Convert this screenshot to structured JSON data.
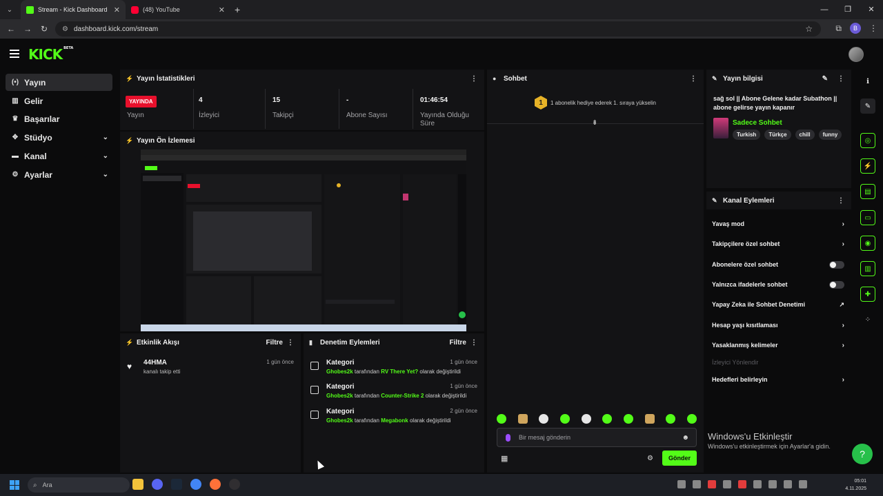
{
  "browser": {
    "tabs": [
      {
        "title": "Stream - Kick Dashboard",
        "favicon": "kick-icon"
      },
      {
        "title": "(48) YouTube",
        "favicon": "youtube-icon"
      }
    ],
    "url": "dashboard.kick.com/stream",
    "profile_initial": "B"
  },
  "brand": {
    "logo": "KICK",
    "badge": "BETA",
    "accent": "#53fc18"
  },
  "sidebar": {
    "items": [
      {
        "label": "Yayın",
        "icon": "broadcast-icon"
      },
      {
        "label": "Gelir",
        "icon": "revenue-icon"
      },
      {
        "label": "Başarılar",
        "icon": "trophy-icon"
      },
      {
        "label": "Stüdyo",
        "icon": "studio-icon"
      },
      {
        "label": "Kanal",
        "icon": "channel-icon"
      },
      {
        "label": "Ayarlar",
        "icon": "settings-icon"
      }
    ]
  },
  "stats": {
    "title": "Yayın İstatistikleri",
    "live_badge": "YAYINDA",
    "live_label": "Yayın",
    "viewers": {
      "value": "4",
      "label": "İzleyici"
    },
    "followers": {
      "value": "15",
      "label": "Takipçi"
    },
    "subscribers": {
      "value": "-",
      "label": "Abone Sayısı"
    },
    "uptime": {
      "value": "01:46:54",
      "label": "Yayında Olduğu Süre"
    }
  },
  "preview": {
    "title": "Yayın Ön İzlemesi"
  },
  "activity": {
    "title": "Etkinlik Akışı",
    "filter": "Filtre",
    "items": [
      {
        "name": "44HMA",
        "text": "kanalı takip etti",
        "time": "1 gün önce"
      }
    ]
  },
  "moderation": {
    "title": "Denetim Eylemleri",
    "filter": "Filtre",
    "items": [
      {
        "title": "Kategori",
        "user": "Ghobes2k",
        "mid": "tarafından",
        "value": "RV There Yet?",
        "end": "olarak değiştirildi",
        "time": "1 gün önce"
      },
      {
        "title": "Kategori",
        "user": "Ghobes2k",
        "mid": "tarafından",
        "value": "Counter-Strike 2",
        "end": "olarak değiştirildi",
        "time": "1 gün önce"
      },
      {
        "title": "Kategori",
        "user": "Ghobes2k",
        "mid": "tarafından",
        "value": "Megabonk",
        "end": "olarak değiştirildi",
        "time": "2 gün önce"
      }
    ]
  },
  "chat": {
    "title": "Sohbet",
    "gift_rank": "1",
    "gift_text": "1 abonelik hediye ederek 1. sıraya yükselin",
    "placeholder": "Bir mesaj gönderin",
    "send": "Gönder"
  },
  "stream_info": {
    "title": "Yayın bilgisi",
    "stream_title": "sağ sol || Abone Gelene kadar Subathon || abone gelirse yayın kapanır",
    "category": "Sadece Sohbet",
    "tags": [
      "Turkish",
      "Türkçe",
      "chill",
      "funny"
    ]
  },
  "channel_actions": {
    "title": "Kanal Eylemleri",
    "items": [
      {
        "label": "Yavaş mod",
        "control": "chevron"
      },
      {
        "label": "Takipçilere özel sohbet",
        "control": "chevron"
      },
      {
        "label": "Abonelere özel sohbet",
        "control": "toggle"
      },
      {
        "label": "Yalnızca ifadelerle sohbet",
        "control": "toggle"
      },
      {
        "label": "Yapay Zeka ile Sohbet Denetimi",
        "control": "external"
      },
      {
        "label": "Hesap yaşı kısıtlaması",
        "control": "chevron"
      },
      {
        "label": "Yasaklanmış kelimeler",
        "control": "chevron"
      },
      {
        "label": "İzleyici Yönlendir",
        "control": "none"
      },
      {
        "label": "Hedefleri belirleyin",
        "control": "chevron"
      }
    ]
  },
  "windows": {
    "watermark_title": "Windows'u Etkinleştir",
    "watermark_sub": "Windows'u etkinleştirmek için Ayarlar'a gidin.",
    "search": "Ara",
    "time": "05:01",
    "date": "4.11.2025"
  }
}
